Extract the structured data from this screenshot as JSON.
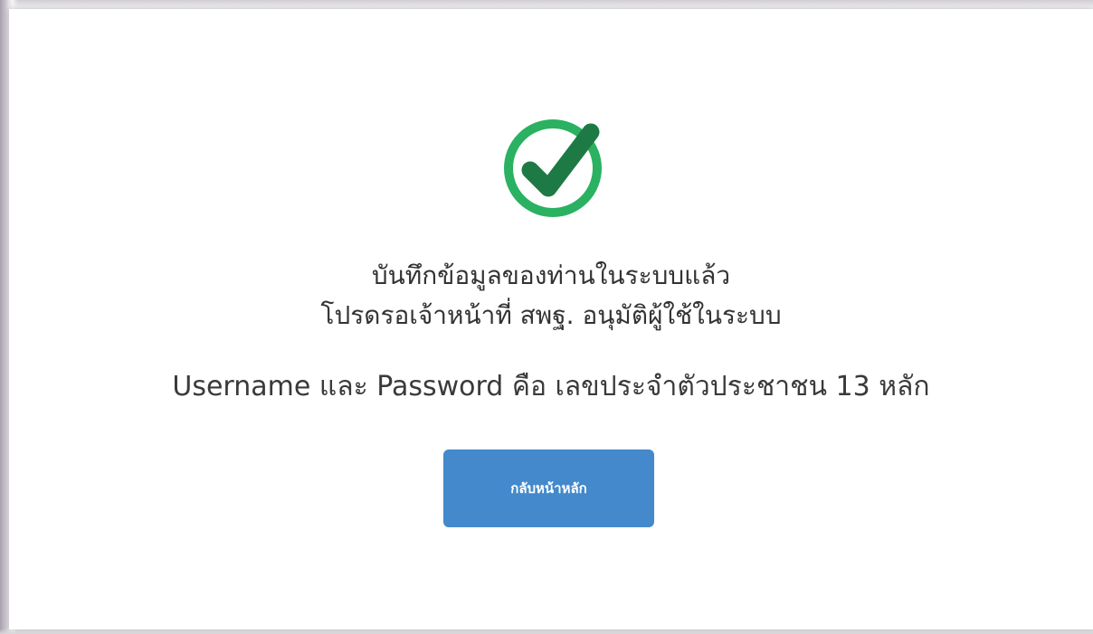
{
  "message": {
    "line1": "บันทึกข้อมูลของท่านในระบบแล้ว",
    "line2": "โปรดรอเจ้าหน้าที่ สพฐ. อนุมัติผู้ใช้ในระบบ",
    "credentials_info": "Username และ Password คือ เลขประจำตัวประชาชน 13 หลัก"
  },
  "actions": {
    "home_button_label": "กลับหน้าหลัก"
  },
  "icons": {
    "status": "check-circle-icon"
  },
  "colors": {
    "success_ring": "#2ab161",
    "success_check": "#1e7a44",
    "button_bg": "#4389cc",
    "button_text": "#ffffff"
  }
}
